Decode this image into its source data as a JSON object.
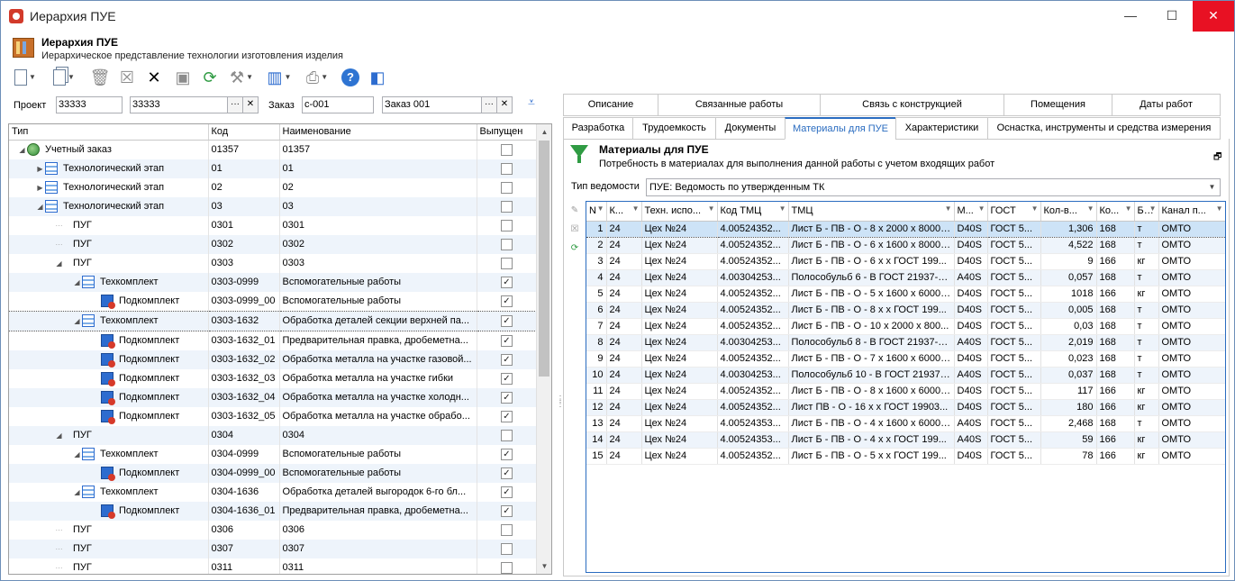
{
  "window": {
    "title": "Иерархия ПУЕ",
    "minimize": "—",
    "maximize": "☐",
    "close": "✕"
  },
  "header": {
    "title": "Иерархия ПУЕ",
    "subtitle": "Иерархическое представление технологии изготовления изделия"
  },
  "toolbar": {
    "icons": [
      "new-document-icon",
      "copy-icon",
      "delete-icon",
      "cancel-icon",
      "cut-icon",
      "save-icon",
      "refresh-icon",
      "tools-icon",
      "chart-icon",
      "print-icon",
      "help-icon",
      "window-icon"
    ],
    "ellipsis": "···",
    "clear": "✕"
  },
  "filters": {
    "project_label": "Проект",
    "project_code": "33333",
    "project_value": "33333",
    "order_label": "Заказ",
    "order_code": "c-001",
    "order_value": "Заказ 001"
  },
  "left_grid": {
    "columns": [
      "Тип",
      "Код",
      "Наименование",
      "Выпущен"
    ],
    "rows": [
      {
        "level": 0,
        "expander": "◢",
        "icon": "globe",
        "type": "Учетный заказ",
        "code": "01357",
        "name": "01357",
        "released": false
      },
      {
        "level": 1,
        "expander": "▶",
        "icon": "stage",
        "type": "Технологический этап",
        "code": "01",
        "name": "01",
        "released": false
      },
      {
        "level": 1,
        "expander": "▶",
        "icon": "stage",
        "type": "Технологический этап",
        "code": "02",
        "name": "02",
        "released": false
      },
      {
        "level": 1,
        "expander": "◢",
        "icon": "stage",
        "type": "Технологический этап",
        "code": "03",
        "name": "03",
        "released": false
      },
      {
        "level": 2,
        "expander": "···",
        "icon": "",
        "type": "ПУГ",
        "code": "0301",
        "name": "0301",
        "released": false
      },
      {
        "level": 2,
        "expander": "···",
        "icon": "",
        "type": "ПУГ",
        "code": "0302",
        "name": "0302",
        "released": false
      },
      {
        "level": 2,
        "expander": "◢",
        "icon": "",
        "type": "ПУГ",
        "code": "0303",
        "name": "0303",
        "released": false
      },
      {
        "level": 3,
        "expander": "◢",
        "icon": "stage",
        "type": "Техкомплект",
        "code": "0303-0999",
        "name": "Вспомогательные работы",
        "released": true
      },
      {
        "level": 4,
        "expander": "",
        "icon": "sub",
        "type": "Подкомплект",
        "code": "0303-0999_00",
        "name": "Вспомогательные работы",
        "released": true
      },
      {
        "level": 3,
        "expander": "◢",
        "icon": "stage",
        "type": "Техкомплект",
        "code": "0303-1632",
        "name": "Обработка деталей секции верхней  па...",
        "released": true
      },
      {
        "level": 4,
        "expander": "",
        "icon": "sub",
        "type": "Подкомплект",
        "code": "0303-1632_01",
        "name": "Предварительная правка, дробеметна...",
        "released": true
      },
      {
        "level": 4,
        "expander": "",
        "icon": "sub",
        "type": "Подкомплект",
        "code": "0303-1632_02",
        "name": "Обработка металла на участке газовой...",
        "released": true
      },
      {
        "level": 4,
        "expander": "",
        "icon": "sub",
        "type": "Подкомплект",
        "code": "0303-1632_03",
        "name": "Обработка металла на участке гибки",
        "released": true
      },
      {
        "level": 4,
        "expander": "",
        "icon": "sub",
        "type": "Подкомплект",
        "code": "0303-1632_04",
        "name": "Обработка металла на участке холодн...",
        "released": true
      },
      {
        "level": 4,
        "expander": "",
        "icon": "sub",
        "type": "Подкомплект",
        "code": "0303-1632_05",
        "name": "Обработка металла на участке обрабо...",
        "released": true
      },
      {
        "level": 2,
        "expander": "◢",
        "icon": "",
        "type": "ПУГ",
        "code": "0304",
        "name": "0304",
        "released": false
      },
      {
        "level": 3,
        "expander": "◢",
        "icon": "stage",
        "type": "Техкомплект",
        "code": "0304-0999",
        "name": "Вспомогательные работы",
        "released": true
      },
      {
        "level": 4,
        "expander": "",
        "icon": "sub",
        "type": "Подкомплект",
        "code": "0304-0999_00",
        "name": "Вспомогательные работы",
        "released": true
      },
      {
        "level": 3,
        "expander": "◢",
        "icon": "stage",
        "type": "Техкомплект",
        "code": "0304-1636",
        "name": "Обработка деталей выгородок 6-го бл...",
        "released": true
      },
      {
        "level": 4,
        "expander": "",
        "icon": "sub",
        "type": "Подкомплект",
        "code": "0304-1636_01",
        "name": "Предварительная правка, дробеметна...",
        "released": true
      },
      {
        "level": 2,
        "expander": "···",
        "icon": "",
        "type": "ПУГ",
        "code": "0306",
        "name": "0306",
        "released": false
      },
      {
        "level": 2,
        "expander": "···",
        "icon": "",
        "type": "ПУГ",
        "code": "0307",
        "name": "0307",
        "released": false
      },
      {
        "level": 2,
        "expander": "···",
        "icon": "",
        "type": "ПУГ",
        "code": "0311",
        "name": "0311",
        "released": false
      }
    ]
  },
  "tabs_top": [
    "Описание",
    "Связанные работы",
    "Связь с конструкцией",
    "Помещения",
    "Даты работ"
  ],
  "tabs_bottom": [
    "Разработка",
    "Трудоемкость",
    "Документы",
    "Материалы для ПУЕ",
    "Характеристики",
    "Оснастка, инструменты и средства измерения"
  ],
  "active_tab": "Материалы для ПУЕ",
  "materials": {
    "title": "Материалы для ПУЕ",
    "subtitle": "Потребность в материалах для выполнения данной работы с учетом входящих работ",
    "ved_label": "Тип ведомости",
    "ved_value": "ПУЕ: Ведомость по утвержденным ТК",
    "columns": [
      "N",
      "К...",
      "Техн. испо...",
      "Код ТМЦ",
      "ТМЦ",
      "М...",
      "ГОСТ",
      "Кол-в...",
      "Ко...",
      "Б...",
      "Канал п..."
    ],
    "rows": [
      [
        "1",
        "24",
        "Цех №24",
        "4.00524352...",
        "Лист Б - ПВ - О - 8 x 2000 x 8000 ...",
        "D40S",
        "ГОСТ 5...",
        "1,306",
        "168",
        "т",
        "ОМТО"
      ],
      [
        "2",
        "24",
        "Цех №24",
        "4.00524352...",
        "Лист Б - ПВ - О - 6 x 1600 x 8000 ...",
        "D40S",
        "ГОСТ 5...",
        "4,522",
        "168",
        "т",
        "ОМТО"
      ],
      [
        "3",
        "24",
        "Цех №24",
        "4.00524352...",
        "Лист Б - ПВ - О - 6 x  x  ГОСТ 199...",
        "D40S",
        "ГОСТ 5...",
        "9",
        "166",
        "кг",
        "ОМТО"
      ],
      [
        "4",
        "24",
        "Цех №24",
        "4.00304253...",
        "Полособульб 6 - В ГОСТ 21937-7...",
        "A40S",
        "ГОСТ 5...",
        "0,057",
        "168",
        "т",
        "ОМТО"
      ],
      [
        "5",
        "24",
        "Цех №24",
        "4.00524352...",
        "Лист Б - ПВ - О - 5 x 1600 x 6000 ...",
        "D40S",
        "ГОСТ 5...",
        "1018",
        "166",
        "кг",
        "ОМТО"
      ],
      [
        "6",
        "24",
        "Цех №24",
        "4.00524352...",
        "Лист Б - ПВ - О - 8 x  x  ГОСТ 199...",
        "D40S",
        "ГОСТ 5...",
        "0,005",
        "168",
        "т",
        "ОМТО"
      ],
      [
        "7",
        "24",
        "Цех №24",
        "4.00524352...",
        "Лист Б - ПВ - О - 10 x 2000 x 800...",
        "D40S",
        "ГОСТ 5...",
        "0,03",
        "168",
        "т",
        "ОМТО"
      ],
      [
        "8",
        "24",
        "Цех №24",
        "4.00304253...",
        "Полособульб 8 - В ГОСТ 21937-7...",
        "A40S",
        "ГОСТ 5...",
        "2,019",
        "168",
        "т",
        "ОМТО"
      ],
      [
        "9",
        "24",
        "Цех №24",
        "4.00524352...",
        "Лист Б - ПВ - О - 7 x 1600 x 6000 ...",
        "D40S",
        "ГОСТ 5...",
        "0,023",
        "168",
        "т",
        "ОМТО"
      ],
      [
        "10",
        "24",
        "Цех №24",
        "4.00304253...",
        "Полособульб 10 - В ГОСТ 21937-...",
        "A40S",
        "ГОСТ 5...",
        "0,037",
        "168",
        "т",
        "ОМТО"
      ],
      [
        "11",
        "24",
        "Цех №24",
        "4.00524352...",
        "Лист Б - ПВ - О - 8 x 1600 x 6000 ...",
        "D40S",
        "ГОСТ 5...",
        "117",
        "166",
        "кг",
        "ОМТО"
      ],
      [
        "12",
        "24",
        "Цех №24",
        "4.00524352...",
        "Лист ПВ - О - 16 x  x  ГОСТ 19903...",
        "D40S",
        "ГОСТ 5...",
        "180",
        "166",
        "кг",
        "ОМТО"
      ],
      [
        "13",
        "24",
        "Цех №24",
        "4.00524353...",
        "Лист Б - ПВ - О - 4 x 1600 x 6000 ...",
        "A40S",
        "ГОСТ 5...",
        "2,468",
        "168",
        "т",
        "ОМТО"
      ],
      [
        "14",
        "24",
        "Цех №24",
        "4.00524353...",
        "Лист Б - ПВ - О - 4 x  x  ГОСТ 199...",
        "A40S",
        "ГОСТ 5...",
        "59",
        "166",
        "кг",
        "ОМТО"
      ],
      [
        "15",
        "24",
        "Цех №24",
        "4.00524352...",
        "Лист Б - ПВ - О - 5 x  x  ГОСТ 199...",
        "D40S",
        "ГОСТ 5...",
        "78",
        "166",
        "кг",
        "ОМТО"
      ]
    ]
  }
}
